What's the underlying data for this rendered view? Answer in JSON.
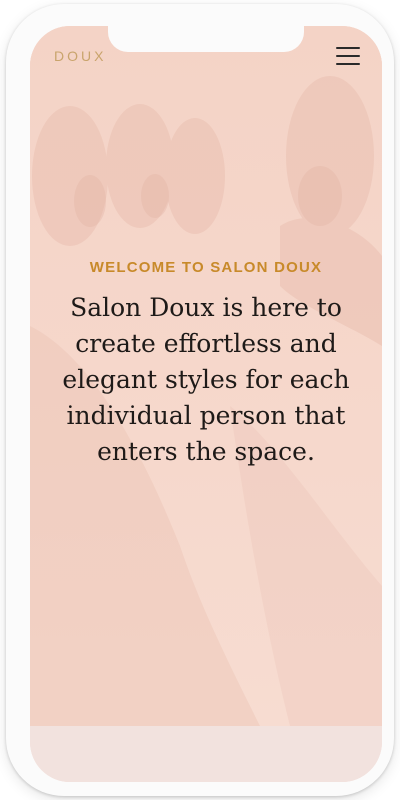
{
  "header": {
    "brand": "DOUX",
    "menu_icon": "hamburger-menu-icon"
  },
  "hero": {
    "eyebrow": "WELCOME TO SALON DOUX",
    "headline": "Salon Doux is here to create effortless and elegant styles for each individual person that enters the space."
  },
  "colors": {
    "accent": "#c88a2a",
    "brand": "#c9a46c",
    "hero_tint": "#f5d5c8",
    "text": "#1e1a18"
  }
}
